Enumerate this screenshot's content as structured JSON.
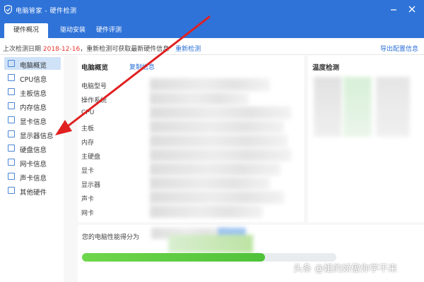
{
  "window": {
    "title": "电脑管家 - 硬件检测",
    "accent_color": "#2f73d8",
    "app_icon": "shield-icon"
  },
  "tabs": [
    {
      "label": "硬件概况",
      "active": true
    },
    {
      "label": "驱动安装",
      "active": false
    },
    {
      "label": "硬件评测",
      "active": false
    }
  ],
  "infobar": {
    "prefix": "上次检测日期",
    "date": "2018-12-16",
    "suffix": "，重新检测可获取最新硬件信息",
    "redetect_link": "重新检测",
    "export_link": "导出配置信息"
  },
  "sidebar": {
    "items": [
      {
        "label": "电脑概览",
        "icon": "pc-icon",
        "active": true
      },
      {
        "label": "CPU信息",
        "icon": "cpu-icon"
      },
      {
        "label": "主板信息",
        "icon": "motherboard-icon"
      },
      {
        "label": "内存信息",
        "icon": "memory-icon"
      },
      {
        "label": "显卡信息",
        "icon": "gpu-icon"
      },
      {
        "label": "显示器信息",
        "icon": "monitor-icon"
      },
      {
        "label": "硬盘信息",
        "icon": "disk-icon"
      },
      {
        "label": "网卡信息",
        "icon": "network-card-icon"
      },
      {
        "label": "声卡信息",
        "icon": "sound-card-icon"
      },
      {
        "label": "其他硬件",
        "icon": "other-hardware-icon"
      }
    ]
  },
  "overview": {
    "title": "电脑概览",
    "copy_link": "复制信息",
    "rows": [
      "电脑型号",
      "操作系统",
      "CPU",
      "主板",
      "内存",
      "主硬盘",
      "显卡",
      "显示器",
      "声卡",
      "网卡"
    ]
  },
  "temperature": {
    "title": "温度检测"
  },
  "performance": {
    "label": "您的电脑性能得分为"
  },
  "annotation": {
    "arrow_color": "#e02020"
  },
  "watermark": "头条 @姐的娇傲你学不来"
}
